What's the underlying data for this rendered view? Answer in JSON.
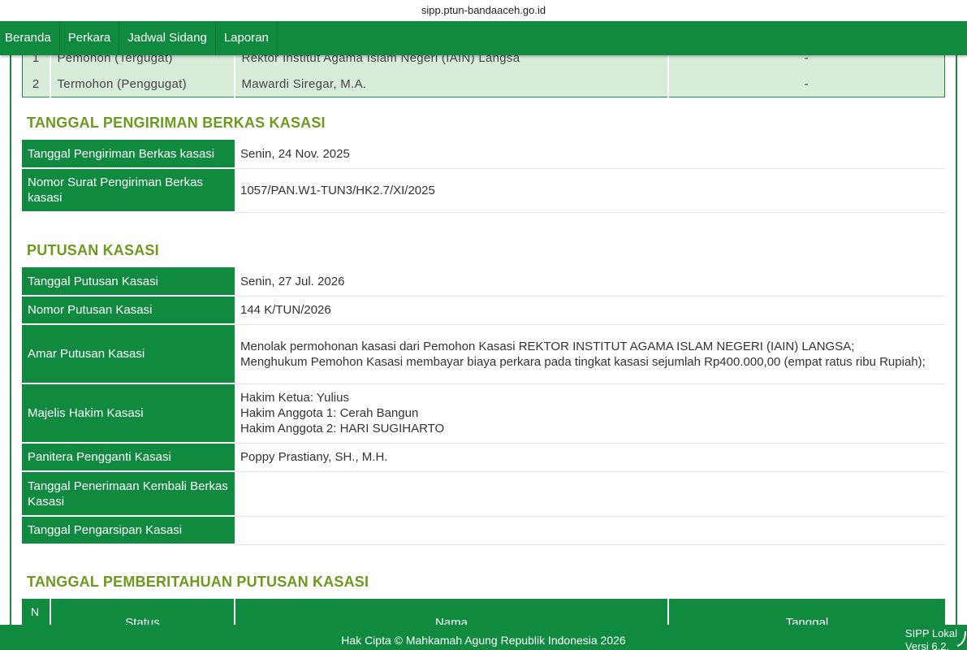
{
  "browser": {
    "url": "sipp.ptun-bandaaceh.go.id"
  },
  "nav": {
    "items": [
      {
        "label": "Beranda"
      },
      {
        "label": "Perkara"
      },
      {
        "label": "Jadwal Sidang"
      },
      {
        "label": "Laporan"
      }
    ]
  },
  "parties": {
    "rows": [
      {
        "no": "1",
        "role": "Pemohon (Tergugat)",
        "name": "Rektor Institut Agama Islam Negeri (IAIN) Langsa",
        "value": "-"
      },
      {
        "no": "2",
        "role": "Termohon (Penggugat)",
        "name": "Mawardi Siregar, M.A.",
        "value": "-"
      }
    ]
  },
  "pengiriman": {
    "title": "TANGGAL PENGIRIMAN BERKAS KASASI",
    "rows": [
      {
        "key": "Tanggal Pengiriman Berkas kasasi",
        "value": "Senin, 24 Nov. 2025"
      },
      {
        "key": "Nomor Surat Pengiriman Berkas kasasi",
        "value": "1057/PAN.W1-TUN3/HK2.7/XI/2025"
      }
    ]
  },
  "putusan": {
    "title": "PUTUSAN KASASI",
    "tanggal_key": "Tanggal Putusan Kasasi",
    "tanggal_value": "Senin, 27 Jul. 2026",
    "nomor_key": "Nomor Putusan Kasasi",
    "nomor_value": "144 K/TUN/2026",
    "amar_key": "Amar Putusan Kasasi",
    "amar_value": "Menolak permohonan kasasi dari Pemohon Kasasi REKTOR INSTITUT AGAMA ISLAM NEGERI (IAIN) LANGSA;\nMenghukum Pemohon Kasasi membayar biaya perkara pada tingkat kasasi sejumlah Rp400.000,00 (empat ratus ribu Rupiah);",
    "majelis_key": "Majelis Hakim Kasasi",
    "majelis_value": "Hakim Ketua: Yulius\nHakim Anggota 1: Cerah Bangun\nHakim Anggota 2: HARI SUGIHARTO",
    "panitera_key": "Panitera Pengganti Kasasi",
    "panitera_value": "Poppy Prastiany, SH., M.H.",
    "penerimaan_key": "Tanggal Penerimaan Kembali Berkas Kasasi",
    "penerimaan_value": "",
    "pengarsipan_key": "Tanggal Pengarsipan Kasasi",
    "pengarsipan_value": ""
  },
  "pemberitahuan": {
    "title": "TANGGAL PEMBERITAHUAN PUTUSAN KASASI",
    "headers": {
      "no": "N",
      "status": "Status",
      "nama": "Nama",
      "tanggal": "Tanggal"
    }
  },
  "footer": {
    "copyright": "Hak Cipta © Mahkamah Agung Republik Indonesia 2026",
    "app": "SIPP Lokal",
    "version": "Versi 6.2."
  },
  "colors": {
    "primary": "#108a3f",
    "section_title": "#6b9a1e",
    "row_bg": "#d8ecd9"
  }
}
